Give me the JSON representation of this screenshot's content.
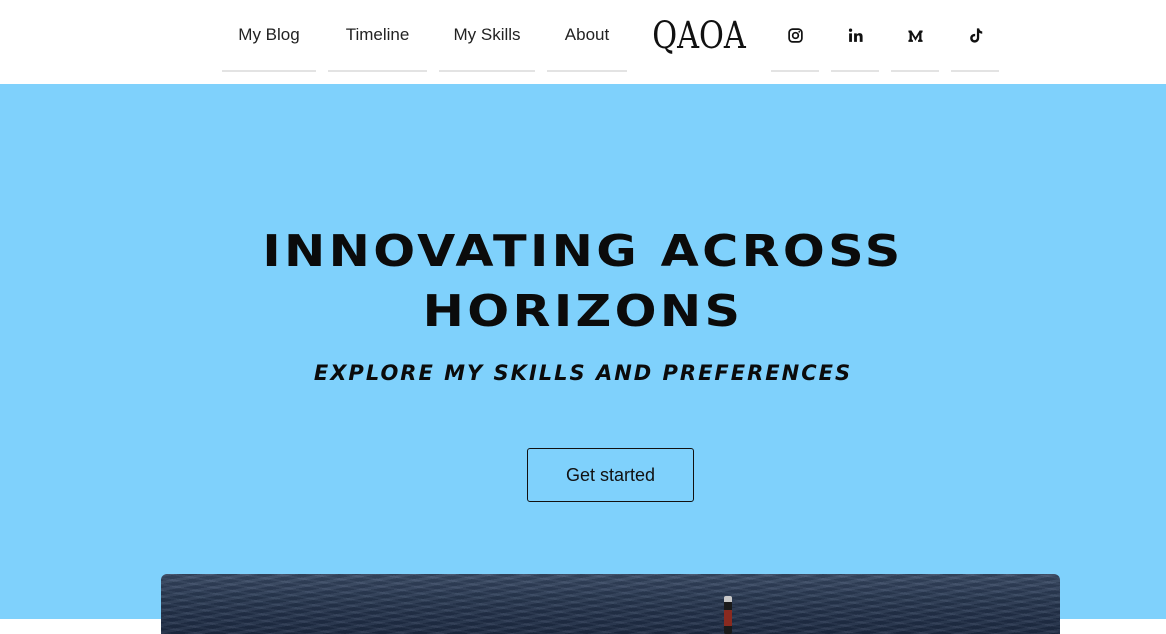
{
  "nav": {
    "items": [
      {
        "label": "My Blog"
      },
      {
        "label": "Timeline"
      },
      {
        "label": "My Skills"
      },
      {
        "label": "About"
      }
    ],
    "logo": "QAOA",
    "social": [
      {
        "icon": "instagram-icon"
      },
      {
        "icon": "linkedin-icon"
      },
      {
        "icon": "medium-icon"
      },
      {
        "icon": "tiktok-icon"
      }
    ]
  },
  "hero": {
    "title": "INNOVATING ACROSS HORIZONS",
    "subtitle": "EXPLORE MY SKILLS AND PREFERENCES",
    "cta_label": "Get started",
    "background_color": "#7fd1fc"
  }
}
